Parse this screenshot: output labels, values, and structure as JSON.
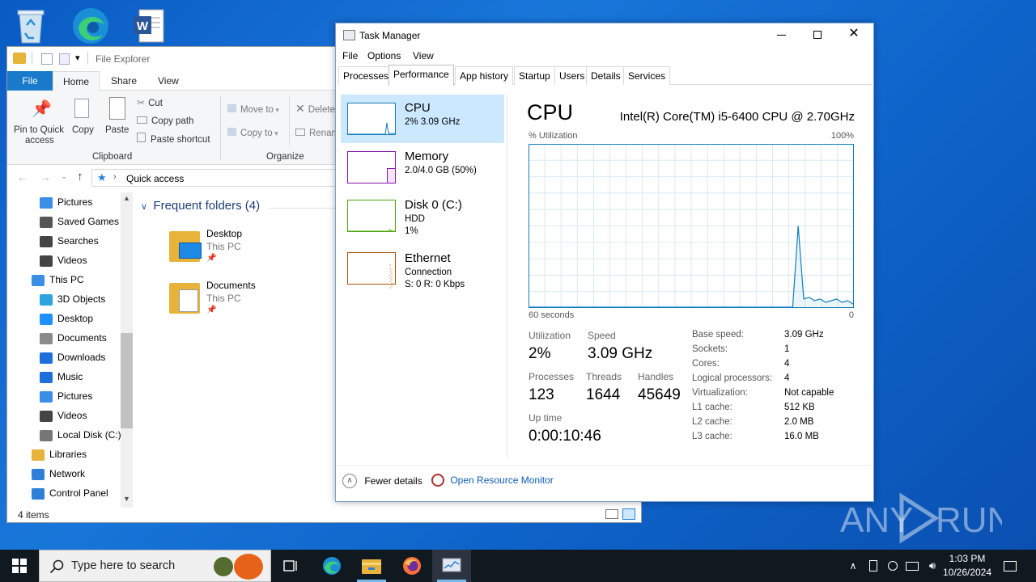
{
  "colors": {
    "cpu": "#117dbb",
    "memory": "#8b12ae",
    "disk": "#4da60c",
    "ethernet": "#a74f01",
    "selected": "#cce8ff",
    "explorer_tab": "#1979ca",
    "taskbar": "#101820"
  },
  "desktop": {
    "icons": [
      "recycle-bin-icon",
      "edge-icon",
      "word-icon"
    ],
    "watermark": "ANY RUN"
  },
  "explorer": {
    "title": "File Explorer",
    "tabs": [
      "File",
      "Home",
      "Share",
      "View"
    ],
    "ribbon": {
      "pin_label_1": "Pin to Quick",
      "pin_label_2": "access",
      "copy": "Copy",
      "paste": "Paste",
      "cut": "Cut",
      "copy_path": "Copy path",
      "paste_shortcut": "Paste shortcut",
      "group_clipboard": "Clipboard",
      "move_to": "Move to",
      "copy_to": "Copy to",
      "delete": "Delete",
      "rename": "Renam",
      "group_organize": "Organize"
    },
    "address": "Quick access",
    "nav": [
      {
        "label": "Pictures",
        "color": "#3a8ee6"
      },
      {
        "label": "Saved Games",
        "color": "#555"
      },
      {
        "label": "Searches",
        "color": "#444"
      },
      {
        "label": "Videos",
        "color": "#444"
      },
      {
        "label": "This PC",
        "color": "#3a8ee6"
      },
      {
        "label": "3D Objects",
        "color": "#2fa2e0"
      },
      {
        "label": "Desktop",
        "color": "#1e90ff"
      },
      {
        "label": "Documents",
        "color": "#8a8a8a"
      },
      {
        "label": "Downloads",
        "color": "#1e6fd9"
      },
      {
        "label": "Music",
        "color": "#1e6fd9"
      },
      {
        "label": "Pictures",
        "color": "#3a8ee6"
      },
      {
        "label": "Videos",
        "color": "#444"
      },
      {
        "label": "Local Disk (C:)",
        "color": "#777"
      },
      {
        "label": "Libraries",
        "color": "#e8b33a"
      },
      {
        "label": "Network",
        "color": "#2f7fd8"
      },
      {
        "label": "Control Panel",
        "color": "#2f7fd8"
      }
    ],
    "section": "Frequent folders (4)",
    "folders": [
      {
        "name": "Desktop",
        "location": "This PC"
      },
      {
        "name": "Documents",
        "location": "This PC"
      }
    ],
    "status": "4 items"
  },
  "task_manager": {
    "title": "Task Manager",
    "menu": [
      "File",
      "Options",
      "View"
    ],
    "tabs": [
      "Processes",
      "Performance",
      "App history",
      "Startup",
      "Users",
      "Details",
      "Services"
    ],
    "active_tab": "Performance",
    "sidebar": [
      {
        "title": "CPU",
        "sub1": "2% 3.09 GHz",
        "sub2": ""
      },
      {
        "title": "Memory",
        "sub1": "2.0/4.0 GB (50%)",
        "sub2": ""
      },
      {
        "title": "Disk 0 (C:)",
        "sub1": "HDD",
        "sub2": "1%"
      },
      {
        "title": "Ethernet",
        "sub1": "Connection",
        "sub2": "S: 0 R: 0 Kbps"
      }
    ],
    "cpu": {
      "heading": "CPU",
      "model": "Intel(R) Core(TM) i5-6400 CPU @ 2.70GHz",
      "util_label": "% Utilization",
      "max_label": "100%",
      "time_label": "60 seconds",
      "min_label": "0",
      "utilization_series": [
        0,
        0,
        0,
        0,
        0,
        0,
        0,
        0,
        0,
        0,
        0,
        0,
        0,
        0,
        0,
        0,
        0,
        0,
        0,
        0,
        0,
        0,
        0,
        0,
        0,
        0,
        0,
        0,
        0,
        0,
        0,
        0,
        0,
        0,
        0,
        0,
        0,
        0,
        0,
        0,
        0,
        0,
        0,
        0,
        0,
        0,
        0,
        0,
        0,
        50,
        5,
        6,
        4,
        5,
        3,
        4,
        5,
        3,
        4,
        2
      ],
      "stats": {
        "utilization_label": "Utilization",
        "utilization": "2%",
        "speed_label": "Speed",
        "speed": "3.09 GHz",
        "processes_label": "Processes",
        "processes": "123",
        "threads_label": "Threads",
        "threads": "1644",
        "handles_label": "Handles",
        "handles": "45649",
        "uptime_label": "Up time",
        "uptime": "0:00:10:46"
      },
      "details": [
        {
          "k": "Base speed:",
          "v": "3.09 GHz"
        },
        {
          "k": "Sockets:",
          "v": "1"
        },
        {
          "k": "Cores:",
          "v": "4"
        },
        {
          "k": "Logical processors:",
          "v": "4"
        },
        {
          "k": "Virtualization:",
          "v": "Not capable"
        },
        {
          "k": "L1 cache:",
          "v": "512 KB"
        },
        {
          "k": "L2 cache:",
          "v": "2.0 MB"
        },
        {
          "k": "L3 cache:",
          "v": "16.0 MB"
        }
      ]
    },
    "footer": {
      "fewer": "Fewer details",
      "resmon": "Open Resource Monitor"
    }
  },
  "taskbar": {
    "search_placeholder": "Type here to search",
    "time": "1:03 PM",
    "date": "10/26/2024"
  }
}
